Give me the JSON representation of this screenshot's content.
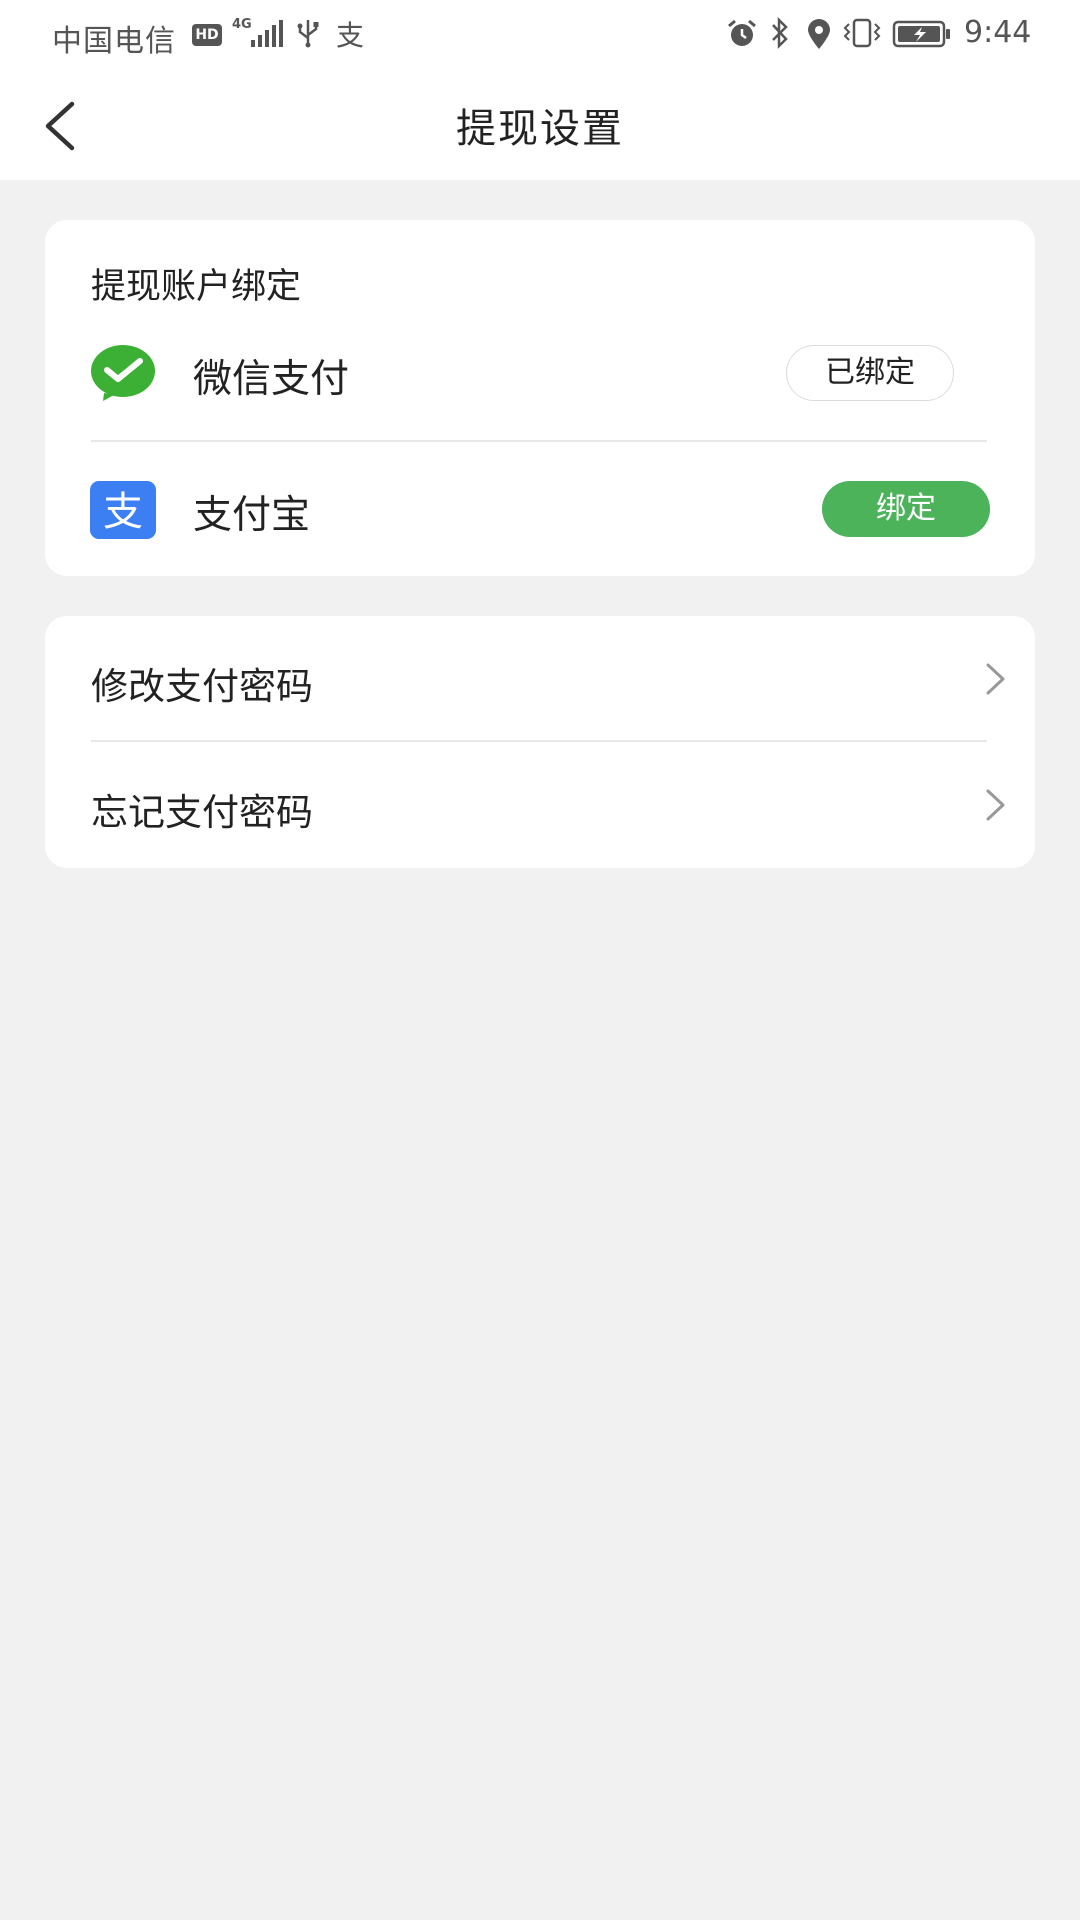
{
  "status_bar": {
    "carrier": "中国电信",
    "hd_badge": "HD",
    "network_type": "4G",
    "time": "9:44",
    "alipay_glyph": "支",
    "icons": [
      "signal-icon",
      "usb-icon",
      "alipay-icon",
      "alarm-icon",
      "bluetooth-icon",
      "location-icon",
      "vibrate-icon",
      "battery-charging-icon"
    ]
  },
  "header": {
    "title": "提现设置",
    "back_icon": "chevron-left-icon"
  },
  "binding": {
    "section_title": "提现账户绑定",
    "accounts": [
      {
        "name": "微信支付",
        "icon": "wechat-pay-icon",
        "action_label": "已绑定",
        "bound": true,
        "color": "#3cb034"
      },
      {
        "name": "支付宝",
        "icon": "alipay-icon",
        "icon_glyph": "支",
        "action_label": "绑定",
        "bound": false,
        "color": "#1677ff"
      }
    ]
  },
  "password_menu": {
    "items": [
      {
        "label": "修改支付密码",
        "icon": "chevron-right-icon"
      },
      {
        "label": "忘记支付密码",
        "icon": "chevron-right-icon"
      }
    ]
  },
  "colors": {
    "accent_green": "#4cb35a",
    "background": "#f1f1f1"
  }
}
